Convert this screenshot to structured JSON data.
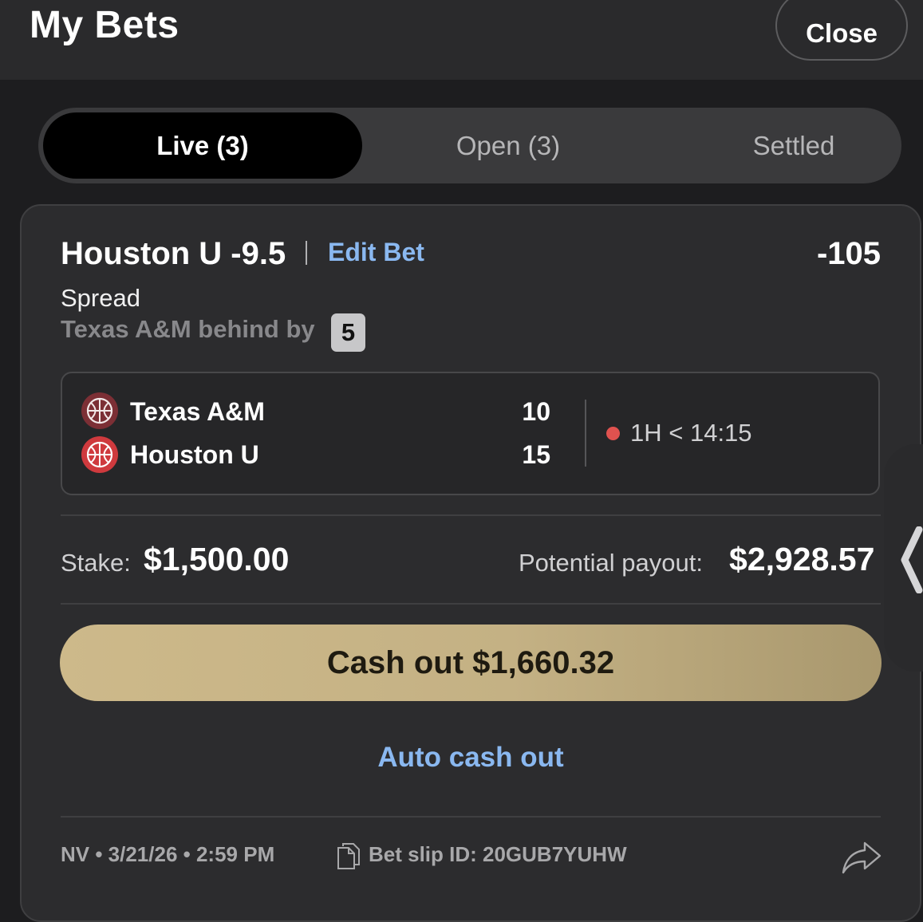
{
  "header": {
    "title": "My Bets",
    "close_label": "Close"
  },
  "tabs": [
    {
      "label": "Live (3)",
      "active": true
    },
    {
      "label": "Open (3)",
      "active": false
    },
    {
      "label": "Settled",
      "active": false
    }
  ],
  "bet": {
    "selection": "Houston U -9.5",
    "edit_label": "Edit Bet",
    "odds": "-105",
    "market": "Spread",
    "status_text": "Texas A&M behind by",
    "status_margin": "5",
    "teams": [
      {
        "name": "Texas A&M",
        "score": "10",
        "icon": "basketball-icon",
        "icon_color": "#7c2f35"
      },
      {
        "name": "Houston U",
        "score": "15",
        "icon": "basketball-icon",
        "icon_color": "#cf3a3e"
      }
    ],
    "game_clock": "1H < 14:15",
    "live_color": "#e0524f",
    "stake_label": "Stake:",
    "stake_value": "$1,500.00",
    "payout_label": "Potential payout:",
    "payout_value": "$2,928.57",
    "cashout_label": "Cash out $1,660.32",
    "auto_cashout_label": "Auto cash out"
  },
  "footer": {
    "meta": "NV • 3/21/26 • 2:59 PM",
    "slip_id_label": "Bet slip ID: 20GUB7YUHW",
    "slip_icon": "copy-icon",
    "share_icon": "share-icon"
  },
  "colors": {
    "accent_gold": "#c8b587",
    "link_blue": "#8ab8f0",
    "background": "#1d1d1f"
  }
}
